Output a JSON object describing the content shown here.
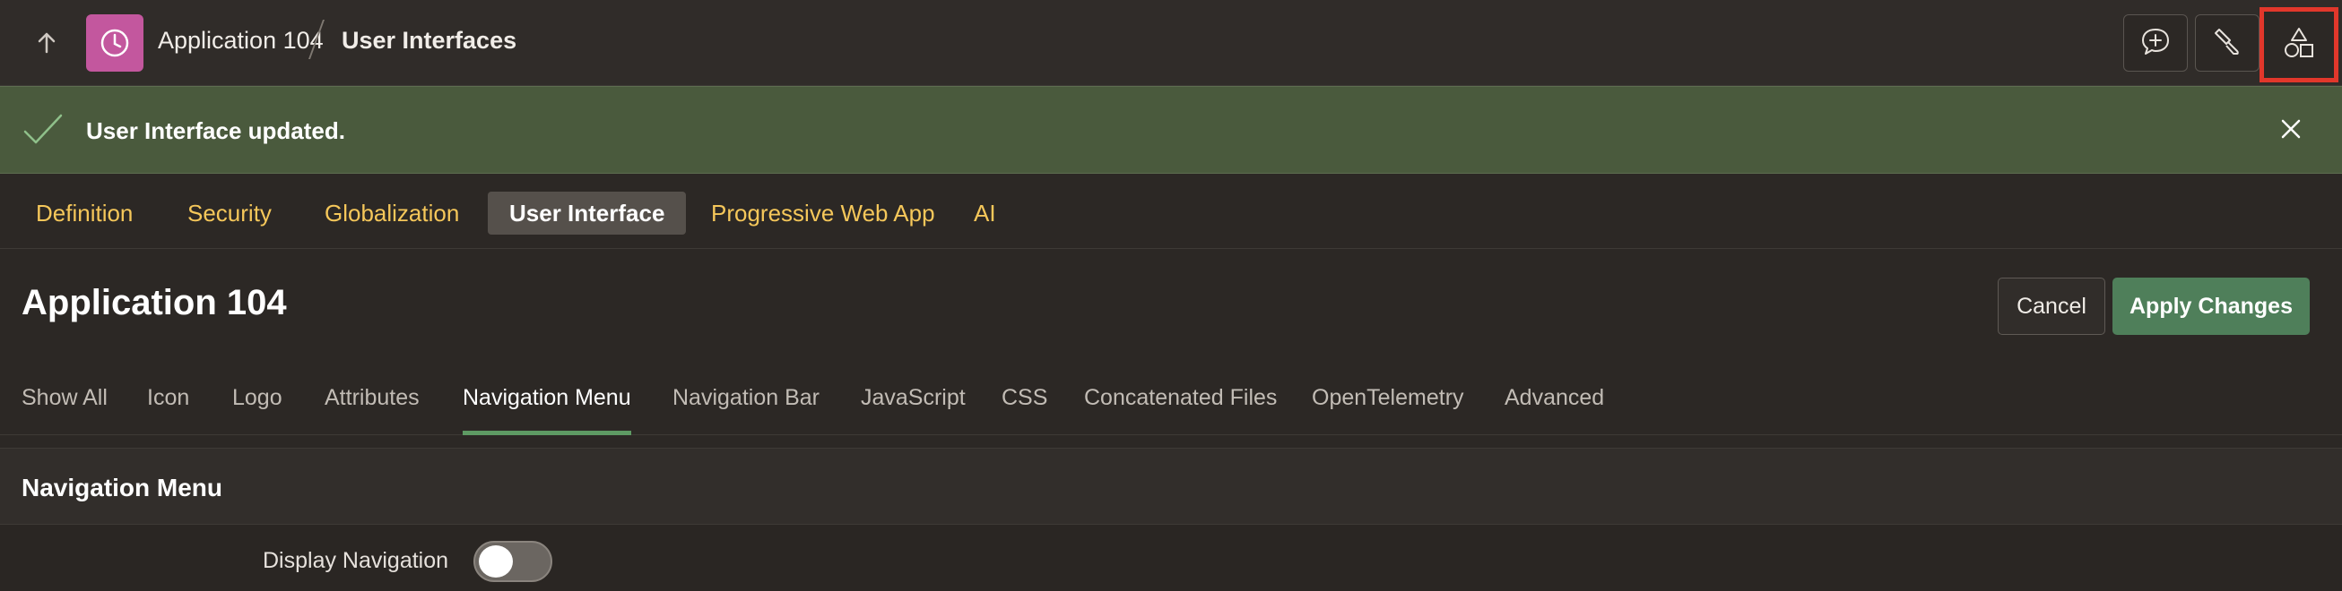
{
  "header": {
    "app_crumb": "Application 104",
    "current_crumb": "User Interfaces",
    "icons": [
      "up-arrow-icon",
      "app-logo-icon",
      "comment-add-icon",
      "brush-icon",
      "shapes-icon"
    ]
  },
  "banner": {
    "message": "User Interface updated.",
    "color": "#4a5a3d"
  },
  "main_tabs": [
    {
      "label": "Definition"
    },
    {
      "label": "Security"
    },
    {
      "label": "Globalization"
    },
    {
      "label": "User Interface",
      "active": true
    },
    {
      "label": "Progressive Web App"
    },
    {
      "label": "AI"
    }
  ],
  "page": {
    "title": "Application 104",
    "cancel_label": "Cancel",
    "apply_label": "Apply Changes"
  },
  "sub_tabs": [
    {
      "label": "Show All"
    },
    {
      "label": "Icon"
    },
    {
      "label": "Logo"
    },
    {
      "label": "Attributes"
    },
    {
      "label": "Navigation Menu",
      "active": true
    },
    {
      "label": "Navigation Bar"
    },
    {
      "label": "JavaScript"
    },
    {
      "label": "CSS"
    },
    {
      "label": "Concatenated Files"
    },
    {
      "label": "OpenTelemetry"
    },
    {
      "label": "Advanced"
    }
  ],
  "region": {
    "title": "Navigation Menu",
    "display_navigation_label": "Display Navigation",
    "display_navigation_value": false
  },
  "colors": {
    "accent_link": "#f5c75a",
    "apply_button": "#4f7f5a",
    "highlight_box": "#e2372b",
    "app_icon": "#c3579e"
  }
}
